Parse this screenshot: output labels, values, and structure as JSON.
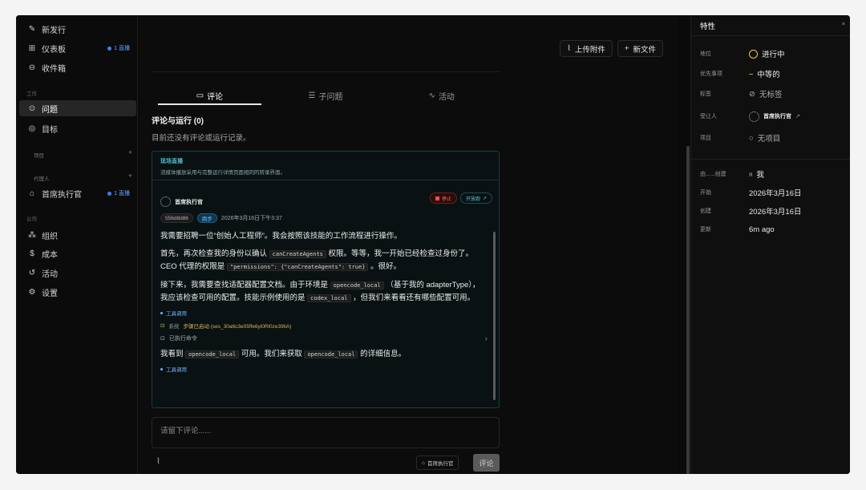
{
  "sidebar": {
    "items": [
      {
        "icon": "edit-icon",
        "glyph": "✎",
        "label": "新发行"
      },
      {
        "icon": "dashboard-icon",
        "glyph": "⊞",
        "label": "仪表板",
        "badge": "1 直播"
      },
      {
        "icon": "inbox-icon",
        "glyph": "⊖",
        "label": "收件箱"
      }
    ],
    "section_work": "工作",
    "issues": {
      "icon": "issue-circle-icon",
      "glyph": "⊙",
      "label": "问题"
    },
    "goals": {
      "icon": "target-icon",
      "glyph": "◎",
      "label": "目标"
    },
    "section_projects": "项目",
    "section_agents": "代理人",
    "agent": {
      "icon": "bot-icon",
      "glyph": "⌂",
      "label": "首席执行官",
      "badge": "1 直播"
    },
    "section_company": "公司",
    "company_items": [
      {
        "icon": "org-icon",
        "glyph": "⁂",
        "label": "组织"
      },
      {
        "icon": "dollar-icon",
        "glyph": "$",
        "label": "成本"
      },
      {
        "icon": "activity-history-icon",
        "glyph": "↺",
        "label": "活动"
      },
      {
        "icon": "settings-gear-icon",
        "glyph": "⚙",
        "label": "设置"
      }
    ]
  },
  "main": {
    "upload_label": "上传附件",
    "new_doc_label": "新文件",
    "tabs": [
      {
        "icon": "comment-icon",
        "glyph": "▭",
        "label": "评论"
      },
      {
        "icon": "list-icon",
        "glyph": "☰",
        "label": "子问题"
      },
      {
        "icon": "activity-icon",
        "glyph": "∿",
        "label": "活动"
      }
    ],
    "heading": "评论与运行 (0)",
    "empty_note": "目前还没有评论或运行记录。",
    "live": {
      "title": "现场直播",
      "desc": "流媒体播放采用与完整运行详情页面相同的转录界面。",
      "agent_name": "首席执行官",
      "stop_label": "停止",
      "open_label": "开放跑",
      "run_id": "556d8d86",
      "status": "跑步",
      "timestamp": "2026年3月16日下午3:37",
      "p1": "我需要招聘一位“创始人工程师”。我会按照该技能的工作流程进行操作。",
      "p2_a": "首先，再次检查我的身份以确认",
      "p2_code": "canCreateAgents",
      "p2_b": "权限。等等，我一开始已经检查过身份了。CEO 代理的权限是",
      "p2_code2": "\"permissions\": {\"canCreateAgents\": true}",
      "p2_c": "。很好。",
      "p3_a": "接下来，我需要查找适配器配置文档。由于环境是",
      "p3_code": "opencode_local",
      "p3_b": "（基于我的 adapterType），我应该检查可用的配置。技能示例使用的是",
      "p3_code2": "codex_local",
      "p3_c": "，但我们来看看还有哪些配置可用。",
      "tool_label": "工具调用",
      "sys_label": "系统",
      "sys_text": "步骤已启动 (ses_30a6c3e05ffe6yi0Rl0ze39tiA)",
      "cmd_label": "已执行命令",
      "p4_a": "我看到",
      "p4_code": "opencode_local",
      "p4_b": "可用。我们来获取",
      "p4_code2": "opencode_local",
      "p4_c": "的详细信息。",
      "tool_label2": "工具调用"
    },
    "comment_placeholder": "请留下评论......",
    "assignee_chip": "首席执行官",
    "submit_label": "评论"
  },
  "props": {
    "title": "特性",
    "close": "×",
    "rows": [
      {
        "label": "地位",
        "value": "进行中"
      },
      {
        "label": "优先事项",
        "value": "中等的",
        "glyph": "–"
      },
      {
        "label": "标签",
        "value": "无标签",
        "glyph": "⊘"
      },
      {
        "label": "受让人",
        "value": "首席执行官",
        "glyph": "↗"
      },
      {
        "label": "项目",
        "value": "无项目",
        "glyph": "○"
      }
    ],
    "rows2": [
      {
        "label": "由......创建",
        "value": "我",
        "glyph": "ᴙ"
      },
      {
        "label": "开始",
        "value": "2026年3月16日"
      },
      {
        "label": "创建",
        "value": "2026年3月16日"
      },
      {
        "label": "更新",
        "value": "6m ago"
      }
    ]
  }
}
